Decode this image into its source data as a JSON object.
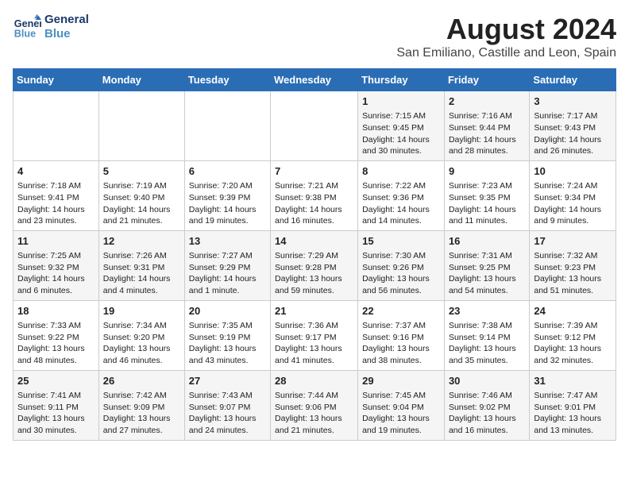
{
  "logo": {
    "text_general": "General",
    "text_blue": "Blue"
  },
  "title": "August 2024",
  "subtitle": "San Emiliano, Castille and Leon, Spain",
  "days_header": [
    "Sunday",
    "Monday",
    "Tuesday",
    "Wednesday",
    "Thursday",
    "Friday",
    "Saturday"
  ],
  "weeks": [
    [
      {
        "day": "",
        "info": ""
      },
      {
        "day": "",
        "info": ""
      },
      {
        "day": "",
        "info": ""
      },
      {
        "day": "",
        "info": ""
      },
      {
        "day": "1",
        "info": "Sunrise: 7:15 AM\nSunset: 9:45 PM\nDaylight: 14 hours and 30 minutes."
      },
      {
        "day": "2",
        "info": "Sunrise: 7:16 AM\nSunset: 9:44 PM\nDaylight: 14 hours and 28 minutes."
      },
      {
        "day": "3",
        "info": "Sunrise: 7:17 AM\nSunset: 9:43 PM\nDaylight: 14 hours and 26 minutes."
      }
    ],
    [
      {
        "day": "4",
        "info": "Sunrise: 7:18 AM\nSunset: 9:41 PM\nDaylight: 14 hours and 23 minutes."
      },
      {
        "day": "5",
        "info": "Sunrise: 7:19 AM\nSunset: 9:40 PM\nDaylight: 14 hours and 21 minutes."
      },
      {
        "day": "6",
        "info": "Sunrise: 7:20 AM\nSunset: 9:39 PM\nDaylight: 14 hours and 19 minutes."
      },
      {
        "day": "7",
        "info": "Sunrise: 7:21 AM\nSunset: 9:38 PM\nDaylight: 14 hours and 16 minutes."
      },
      {
        "day": "8",
        "info": "Sunrise: 7:22 AM\nSunset: 9:36 PM\nDaylight: 14 hours and 14 minutes."
      },
      {
        "day": "9",
        "info": "Sunrise: 7:23 AM\nSunset: 9:35 PM\nDaylight: 14 hours and 11 minutes."
      },
      {
        "day": "10",
        "info": "Sunrise: 7:24 AM\nSunset: 9:34 PM\nDaylight: 14 hours and 9 minutes."
      }
    ],
    [
      {
        "day": "11",
        "info": "Sunrise: 7:25 AM\nSunset: 9:32 PM\nDaylight: 14 hours and 6 minutes."
      },
      {
        "day": "12",
        "info": "Sunrise: 7:26 AM\nSunset: 9:31 PM\nDaylight: 14 hours and 4 minutes."
      },
      {
        "day": "13",
        "info": "Sunrise: 7:27 AM\nSunset: 9:29 PM\nDaylight: 14 hours and 1 minute."
      },
      {
        "day": "14",
        "info": "Sunrise: 7:29 AM\nSunset: 9:28 PM\nDaylight: 13 hours and 59 minutes."
      },
      {
        "day": "15",
        "info": "Sunrise: 7:30 AM\nSunset: 9:26 PM\nDaylight: 13 hours and 56 minutes."
      },
      {
        "day": "16",
        "info": "Sunrise: 7:31 AM\nSunset: 9:25 PM\nDaylight: 13 hours and 54 minutes."
      },
      {
        "day": "17",
        "info": "Sunrise: 7:32 AM\nSunset: 9:23 PM\nDaylight: 13 hours and 51 minutes."
      }
    ],
    [
      {
        "day": "18",
        "info": "Sunrise: 7:33 AM\nSunset: 9:22 PM\nDaylight: 13 hours and 48 minutes."
      },
      {
        "day": "19",
        "info": "Sunrise: 7:34 AM\nSunset: 9:20 PM\nDaylight: 13 hours and 46 minutes."
      },
      {
        "day": "20",
        "info": "Sunrise: 7:35 AM\nSunset: 9:19 PM\nDaylight: 13 hours and 43 minutes."
      },
      {
        "day": "21",
        "info": "Sunrise: 7:36 AM\nSunset: 9:17 PM\nDaylight: 13 hours and 41 minutes."
      },
      {
        "day": "22",
        "info": "Sunrise: 7:37 AM\nSunset: 9:16 PM\nDaylight: 13 hours and 38 minutes."
      },
      {
        "day": "23",
        "info": "Sunrise: 7:38 AM\nSunset: 9:14 PM\nDaylight: 13 hours and 35 minutes."
      },
      {
        "day": "24",
        "info": "Sunrise: 7:39 AM\nSunset: 9:12 PM\nDaylight: 13 hours and 32 minutes."
      }
    ],
    [
      {
        "day": "25",
        "info": "Sunrise: 7:41 AM\nSunset: 9:11 PM\nDaylight: 13 hours and 30 minutes."
      },
      {
        "day": "26",
        "info": "Sunrise: 7:42 AM\nSunset: 9:09 PM\nDaylight: 13 hours and 27 minutes."
      },
      {
        "day": "27",
        "info": "Sunrise: 7:43 AM\nSunset: 9:07 PM\nDaylight: 13 hours and 24 minutes."
      },
      {
        "day": "28",
        "info": "Sunrise: 7:44 AM\nSunset: 9:06 PM\nDaylight: 13 hours and 21 minutes."
      },
      {
        "day": "29",
        "info": "Sunrise: 7:45 AM\nSunset: 9:04 PM\nDaylight: 13 hours and 19 minutes."
      },
      {
        "day": "30",
        "info": "Sunrise: 7:46 AM\nSunset: 9:02 PM\nDaylight: 13 hours and 16 minutes."
      },
      {
        "day": "31",
        "info": "Sunrise: 7:47 AM\nSunset: 9:01 PM\nDaylight: 13 hours and 13 minutes."
      }
    ]
  ]
}
